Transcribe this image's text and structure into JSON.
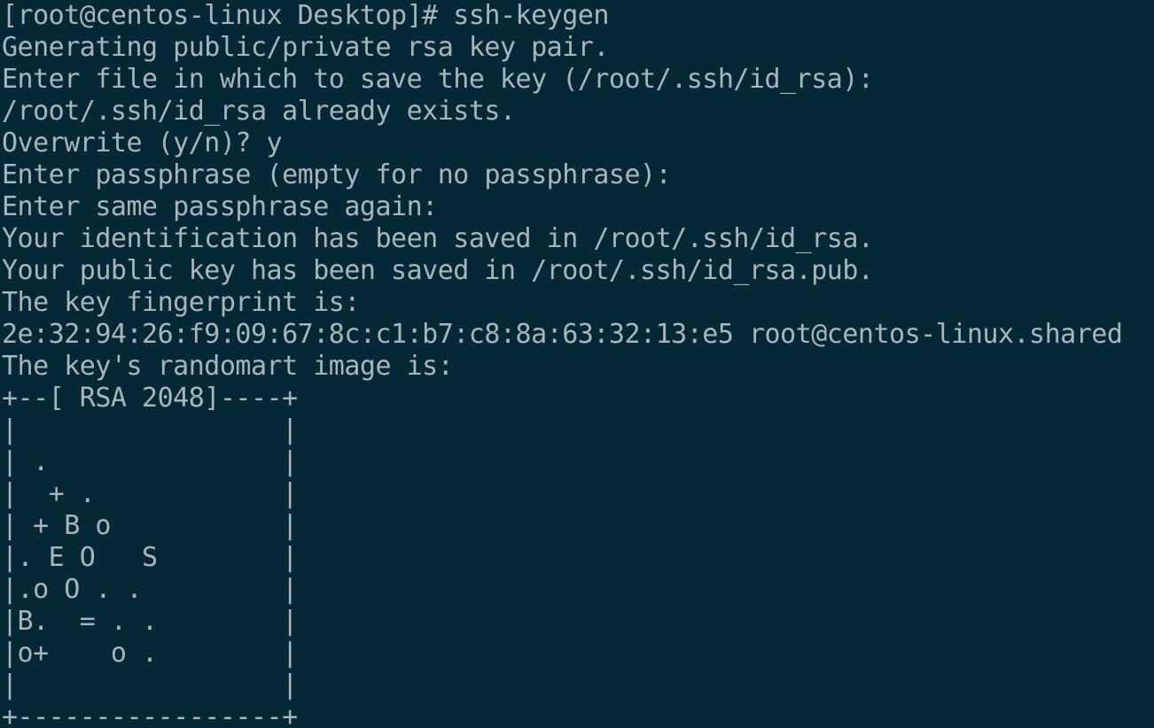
{
  "terminal": {
    "background_color": "#042835",
    "text_color": "#a7b6b8",
    "lines": [
      "[root@centos-linux Desktop]# ssh-keygen",
      "Generating public/private rsa key pair.",
      "Enter file in which to save the key (/root/.ssh/id_rsa):",
      "/root/.ssh/id_rsa already exists.",
      "Overwrite (y/n)? y",
      "Enter passphrase (empty for no passphrase):",
      "Enter same passphrase again:",
      "Your identification has been saved in /root/.ssh/id_rsa.",
      "Your public key has been saved in /root/.ssh/id_rsa.pub.",
      "The key fingerprint is:",
      "2e:32:94:26:f9:09:67:8c:c1:b7:c8:8a:63:32:13:e5 root@centos-linux.shared",
      "The key's randomart image is:",
      "+--[ RSA 2048]----+",
      "|                 |",
      "| .               |",
      "|  + .            |",
      "| + B o           |",
      "|. E O   S        |",
      "|.o O . .         |",
      "|B.  = . .        |",
      "|o+    o .        |",
      "|                 |",
      "+-----------------+"
    ]
  }
}
